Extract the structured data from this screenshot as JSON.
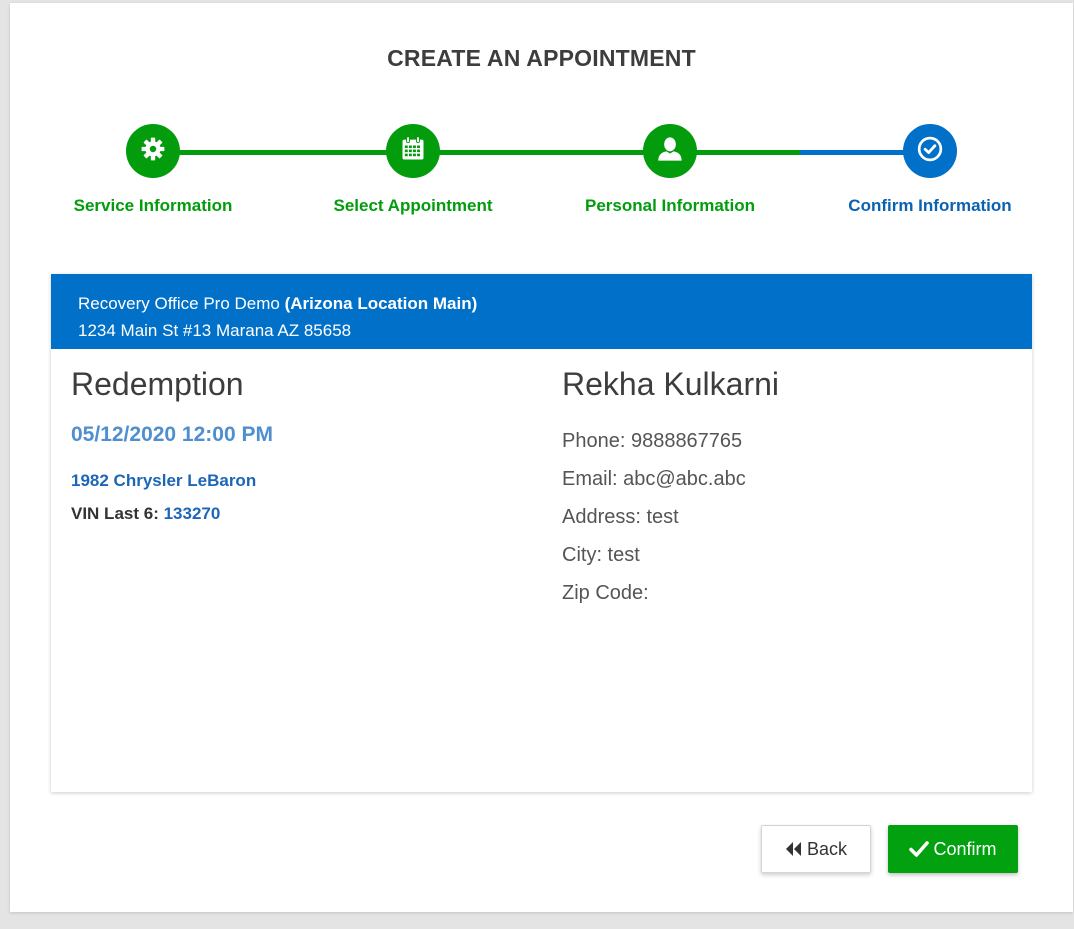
{
  "page": {
    "title": "CREATE AN APPOINTMENT"
  },
  "stepper": {
    "steps": [
      {
        "label": "Service Information",
        "icon": "gear-icon",
        "state": "complete"
      },
      {
        "label": "Select Appointment",
        "icon": "calendar-icon",
        "state": "complete"
      },
      {
        "label": "Personal Information",
        "icon": "user-icon",
        "state": "complete"
      },
      {
        "label": "Confirm Information",
        "icon": "check-circle-icon",
        "state": "current"
      }
    ],
    "colors": {
      "complete": "#029c0d",
      "current": "#0170c9"
    }
  },
  "location": {
    "company": "Recovery Office Pro Demo",
    "name": "(Arizona Location Main)",
    "address": "1234 Main St #13 Marana AZ 85658"
  },
  "appointment": {
    "service": "Redemption",
    "datetime": "05/12/2020 12:00 PM",
    "vehicle": "1982 Chrysler LeBaron",
    "vin_label": "VIN Last 6:",
    "vin_value": "133270"
  },
  "customer": {
    "name": "Rekha Kulkarni",
    "phone": "Phone: 9888867765",
    "email": "Email: abc@abc.abc",
    "address": "Address: test",
    "city": "City: test",
    "zip": "Zip Code:"
  },
  "actions": {
    "back_label": "Back",
    "confirm_label": "Confirm"
  }
}
